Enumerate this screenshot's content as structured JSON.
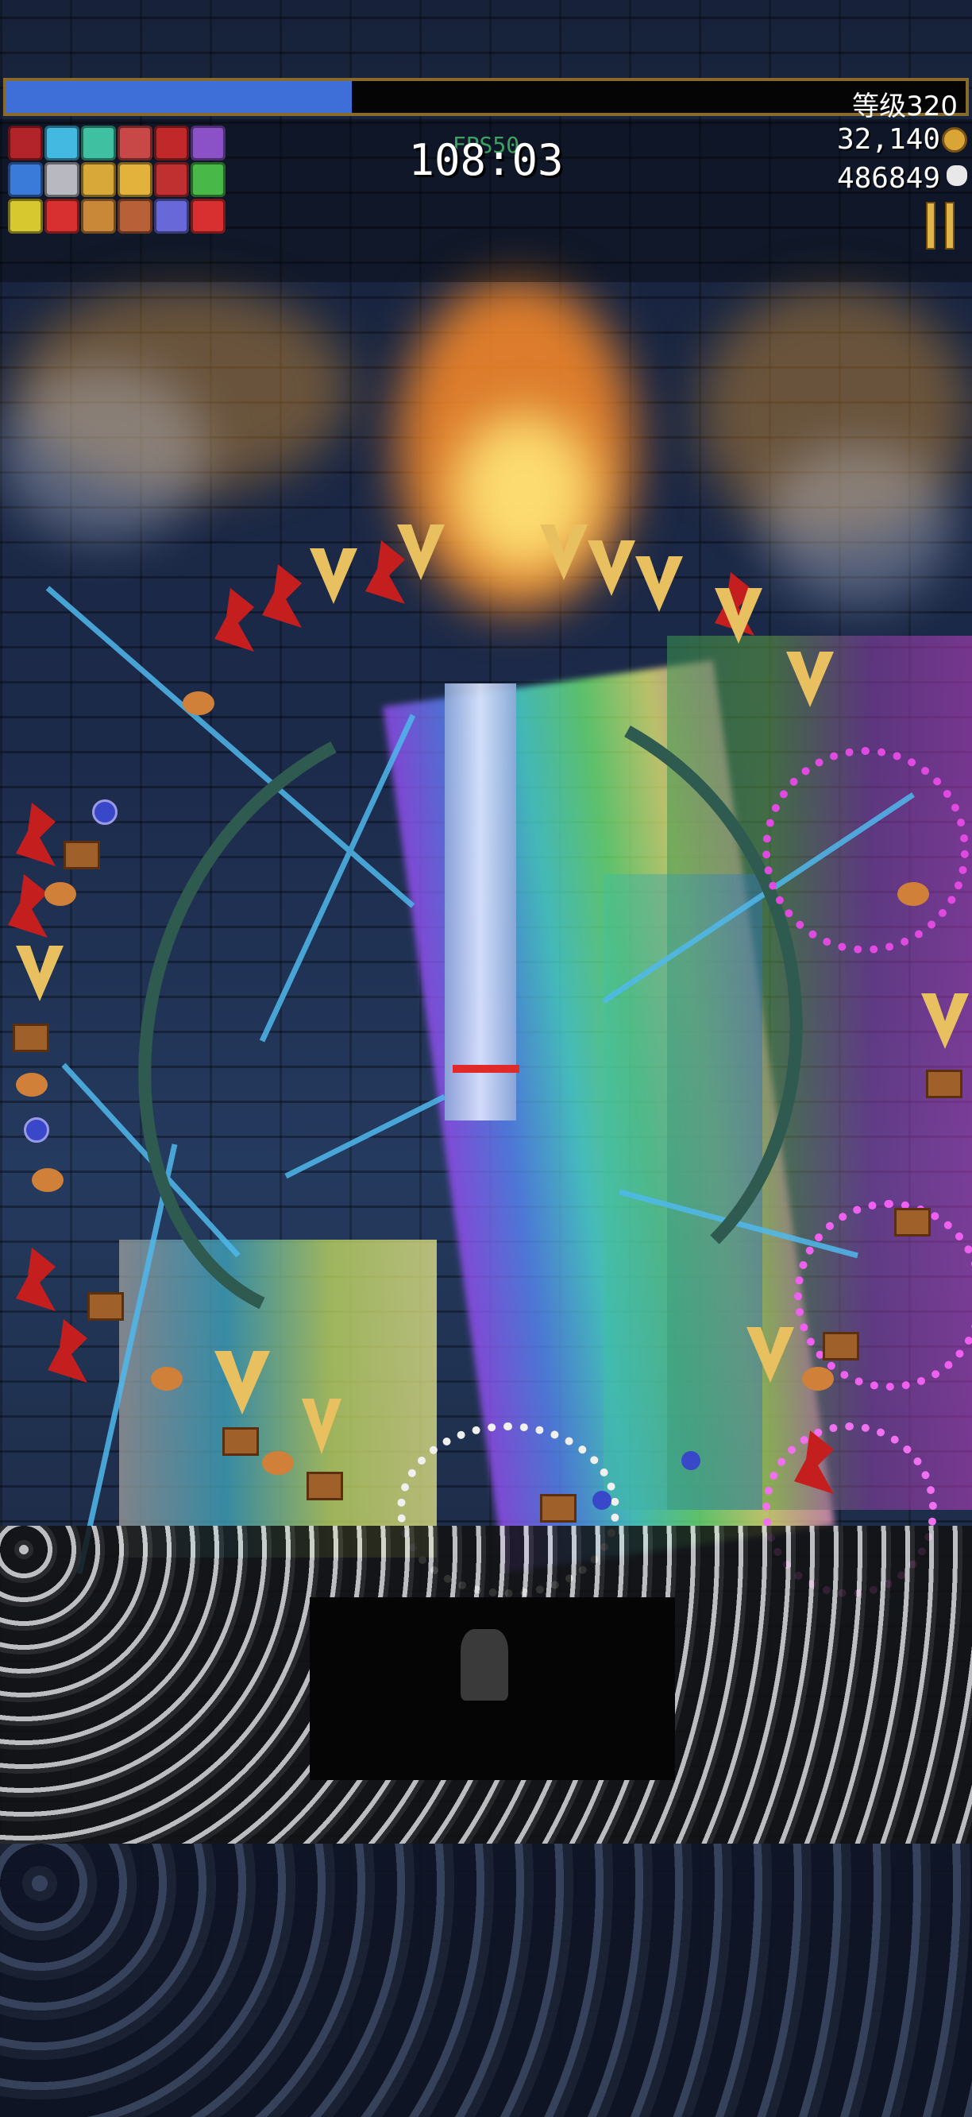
{
  "hud": {
    "xp_progress": 0.36,
    "level_label": "等级320",
    "timer": "108:03",
    "fps": "FPS50",
    "gold": "32,140",
    "kills": "486849"
  },
  "icons": {
    "gold": "coin-icon",
    "kills": "skull-icon",
    "pause": "pause-icon"
  },
  "weapons": [
    {
      "name": "tome-icon",
      "color": "#b2242a"
    },
    {
      "name": "laurel-ring-icon",
      "color": "#43b8e0"
    },
    {
      "name": "wings-icon",
      "color": "#3fc0a0"
    },
    {
      "name": "cross-shuriken-icon",
      "color": "#c84848"
    },
    {
      "name": "cape-icon",
      "color": "#c0282a"
    },
    {
      "name": "spiral-ring-icon",
      "color": "#8b52c8"
    }
  ],
  "passives": [
    {
      "name": "clover-icon",
      "color": "#3a7ad8"
    },
    {
      "name": "gear-icon",
      "color": "#b8b8c0"
    },
    {
      "name": "trident-icon",
      "color": "#d8a838"
    },
    {
      "name": "crown-icon",
      "color": "#e2b23c"
    },
    {
      "name": "armor-icon",
      "color": "#c03030"
    },
    {
      "name": "leaf-icon",
      "color": "#48b848"
    }
  ],
  "extras": [
    {
      "name": "halo-ring-icon",
      "color": "#d8c830"
    },
    {
      "name": "arrow-left-icon",
      "color": "#d83030"
    },
    {
      "name": "cage-icon",
      "color": "#c88838"
    },
    {
      "name": "dagger-icon",
      "color": "#b86038"
    },
    {
      "name": "orb-ring-icon",
      "color": "#6868d8"
    },
    {
      "name": "arrow-right-icon",
      "color": "#d83030"
    }
  ],
  "colors": {
    "xp_fill": "#3e6fd8",
    "frame": "#8a6a2a",
    "boss_health": "#e02a2a"
  }
}
